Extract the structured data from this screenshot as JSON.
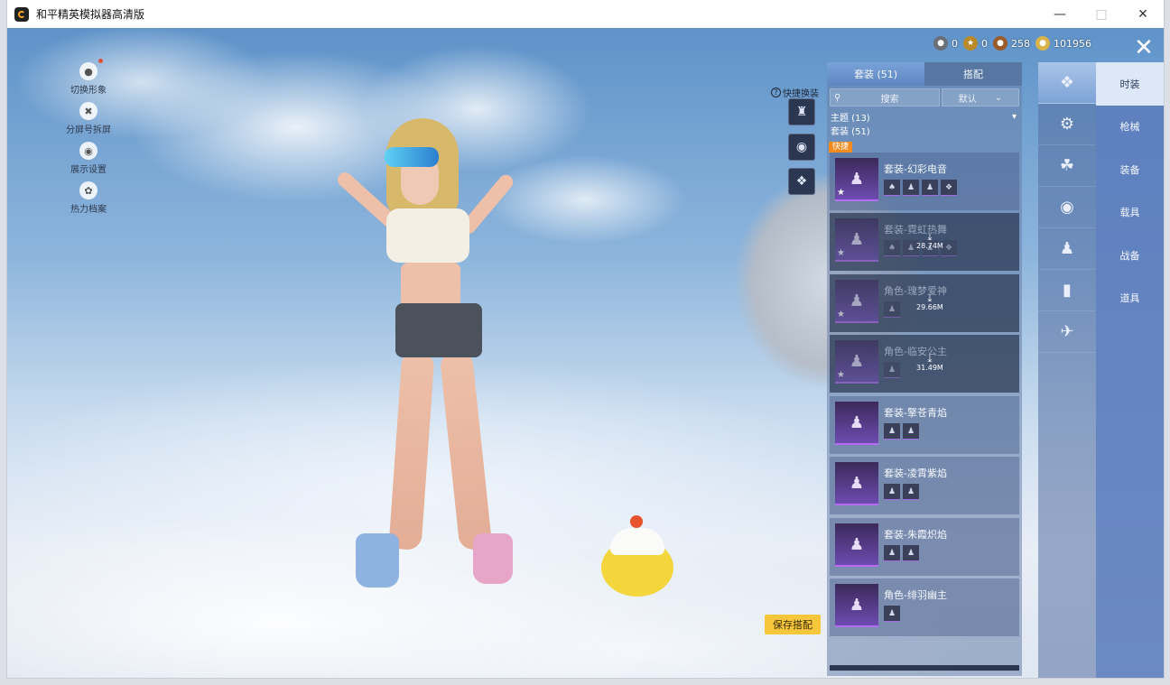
{
  "window": {
    "title": "和平精英模拟器高清版",
    "controls": [
      "minimize",
      "maximize",
      "close"
    ]
  },
  "left_menu": [
    {
      "label": "切换形象",
      "icon": "avatar-icon",
      "badge": true
    },
    {
      "label": "分屏号拆屏",
      "icon": "split-icon",
      "badge": false
    },
    {
      "label": "展示设置",
      "icon": "eye-icon",
      "badge": false
    },
    {
      "label": "热力档案",
      "icon": "flame-icon",
      "badge": false
    }
  ],
  "currency": [
    {
      "icon": "medal-icon",
      "value": "0",
      "color": "#6b6f78"
    },
    {
      "icon": "gold-badge-icon",
      "value": "0",
      "color": "#b98a2a"
    },
    {
      "icon": "bronze-coin-icon",
      "value": "258",
      "color": "#9a5c2a"
    },
    {
      "icon": "gold-coin-icon",
      "value": "101956",
      "color": "#d8b24a"
    }
  ],
  "quick_change": {
    "label": "快捷换装",
    "help_icon": "?"
  },
  "save_button": "保存搭配",
  "panel": {
    "tabs": [
      {
        "label": "套装 (51)",
        "active": true
      },
      {
        "label": "搭配",
        "active": false
      }
    ],
    "search_placeholder": "搜索",
    "sort": "默认",
    "filter_theme": "主题 (13)",
    "section": "套装 (51)",
    "quick_tag": "快捷",
    "items": [
      {
        "name": "套装-幻彩电音",
        "parts": 4,
        "downloading": false,
        "size": ""
      },
      {
        "name": "套装-霓虹热舞",
        "parts": 4,
        "downloading": true,
        "size": "28.74M"
      },
      {
        "name": "角色-瑰梦爱神",
        "parts": 1,
        "downloading": true,
        "size": "29.66M"
      },
      {
        "name": "角色-临安公主",
        "parts": 1,
        "downloading": true,
        "size": "31.49M"
      },
      {
        "name": "套装-擎苍青焰",
        "parts": 2,
        "downloading": false,
        "size": ""
      },
      {
        "name": "套装-凌霄紫焰",
        "parts": 2,
        "downloading": false,
        "size": ""
      },
      {
        "name": "套装-朱霞炽焰",
        "parts": 2,
        "downloading": false,
        "size": ""
      },
      {
        "name": "角色-绯羽幽主",
        "parts": 1,
        "downloading": false,
        "size": ""
      }
    ]
  },
  "rail_icons": [
    "outfit-icon",
    "weapon-icon",
    "gear-icon",
    "helmet-icon",
    "parachute-icon",
    "pants-icon",
    "vehicle-icon"
  ],
  "categories": [
    {
      "label": "时装",
      "active": true
    },
    {
      "label": "枪械",
      "active": false
    },
    {
      "label": "装备",
      "active": false
    },
    {
      "label": "载具",
      "active": false
    },
    {
      "label": "战备",
      "active": false
    },
    {
      "label": "道具",
      "active": false
    }
  ]
}
